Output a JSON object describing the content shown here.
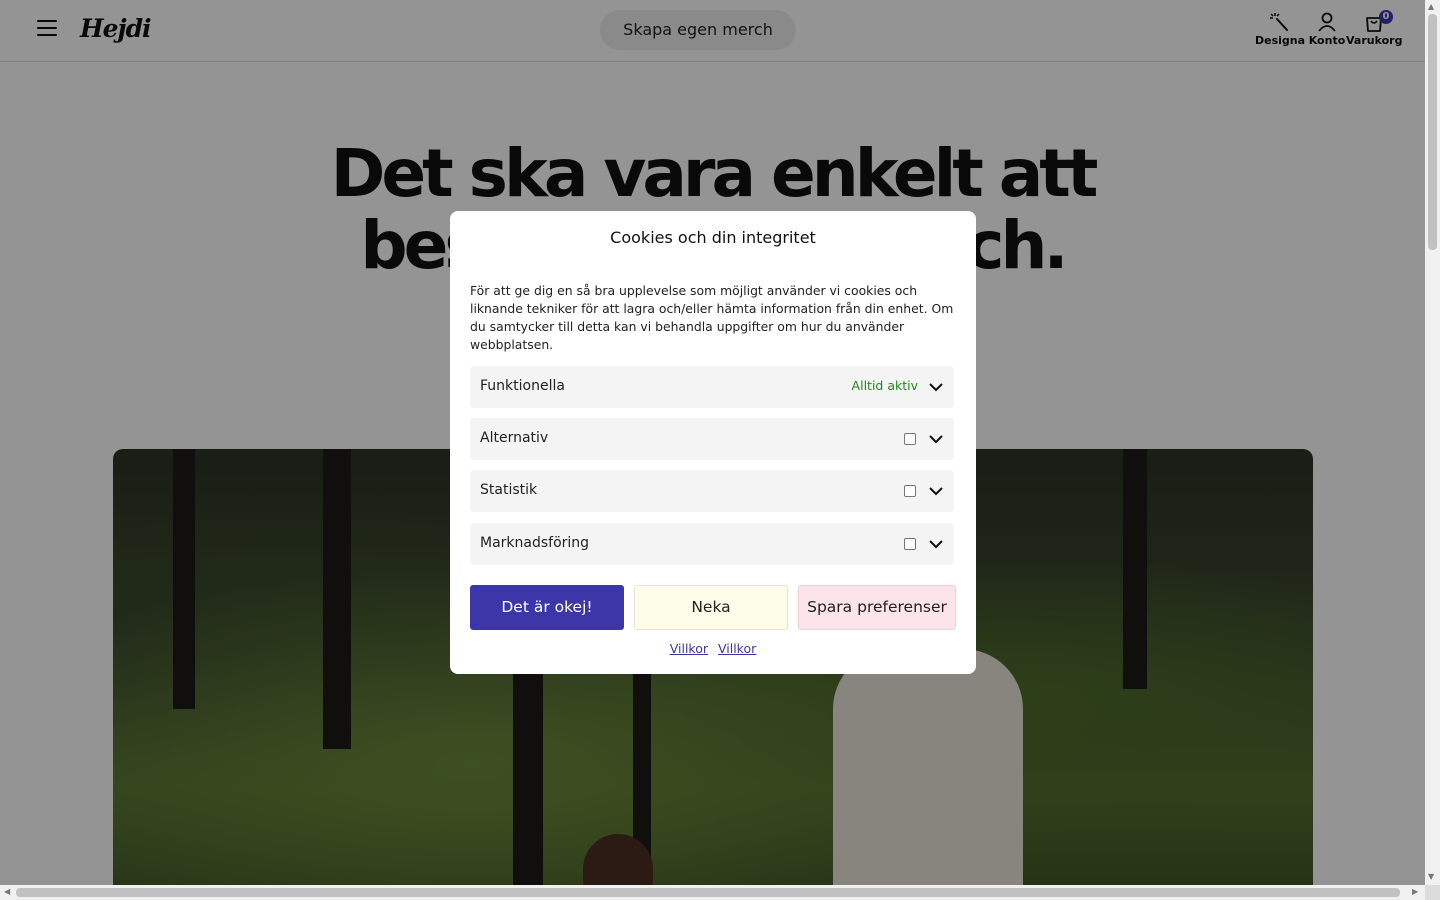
{
  "header": {
    "logo": "Hejdi",
    "create_button": "Skapa egen merch",
    "nav": {
      "design_label": "Designa",
      "account_label": "Konto",
      "cart_label": "Varukorg",
      "cart_count": "0"
    }
  },
  "hero": {
    "title_line1": "Det ska vara enkelt att",
    "title_line2": "beställa egen merch."
  },
  "cookie_dialog": {
    "title": "Cookies och din integritet",
    "description": "För att ge dig en så bra upplevelse som möjligt använder vi cookies och liknande tekniker för att lagra och/eller hämta information från din enhet. Om du samtycker till detta kan vi behandla uppgifter om hur du använder webbplatsen.",
    "categories": [
      {
        "label": "Funktionella",
        "status": "Alltid aktiv"
      },
      {
        "label": "Alternativ",
        "checked": false
      },
      {
        "label": "Statistik",
        "checked": false
      },
      {
        "label": "Marknadsföring",
        "checked": false
      }
    ],
    "buttons": {
      "accept": "Det är okej!",
      "deny": "Neka",
      "save": "Spara preferenser"
    },
    "links": [
      "Villkor",
      "Villkor"
    ],
    "colors": {
      "accept_bg": "#3d36a8",
      "deny_bg": "#fdfde9",
      "save_bg": "#fde4ea",
      "status_green": "#1e8a1e"
    }
  }
}
